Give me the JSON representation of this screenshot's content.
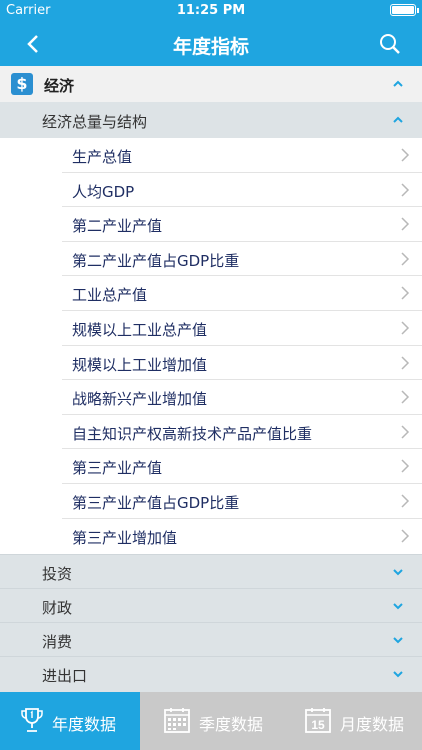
{
  "status_bar": {
    "carrier": "Carrier",
    "time": "11:25 PM"
  },
  "nav": {
    "title": "年度指标",
    "back_icon": "chevron-left-icon",
    "search_icon": "search-icon"
  },
  "category": {
    "icon": "$",
    "label": "经济"
  },
  "subcategory": {
    "label": "经济总量与结构"
  },
  "items": [
    "生产总值",
    "人均GDP",
    "第二产业产值",
    "第二产业产值占GDP比重",
    "工业总产值",
    "规模以上工业总产值",
    "规模以上工业增加值",
    "战略新兴产业增加值",
    "自主知识产权高新技术产品产值比重",
    "第三产业产值",
    "第三产业产值占GDP比重",
    "第三产业增加值"
  ],
  "groups": [
    "投资",
    "财政",
    "消费",
    "进出口"
  ],
  "tabs": [
    {
      "label": "年度数据",
      "icon": "trophy-icon",
      "active": true
    },
    {
      "label": "季度数据",
      "icon": "calendar-grid-icon",
      "active": false
    },
    {
      "label": "月度数据",
      "icon": "calendar-15-icon",
      "active": false,
      "icon_text": "15"
    }
  ],
  "colors": {
    "accent": "#1fa5e0",
    "item_text": "#1f2e63",
    "chevron": "#1fa5e0"
  }
}
